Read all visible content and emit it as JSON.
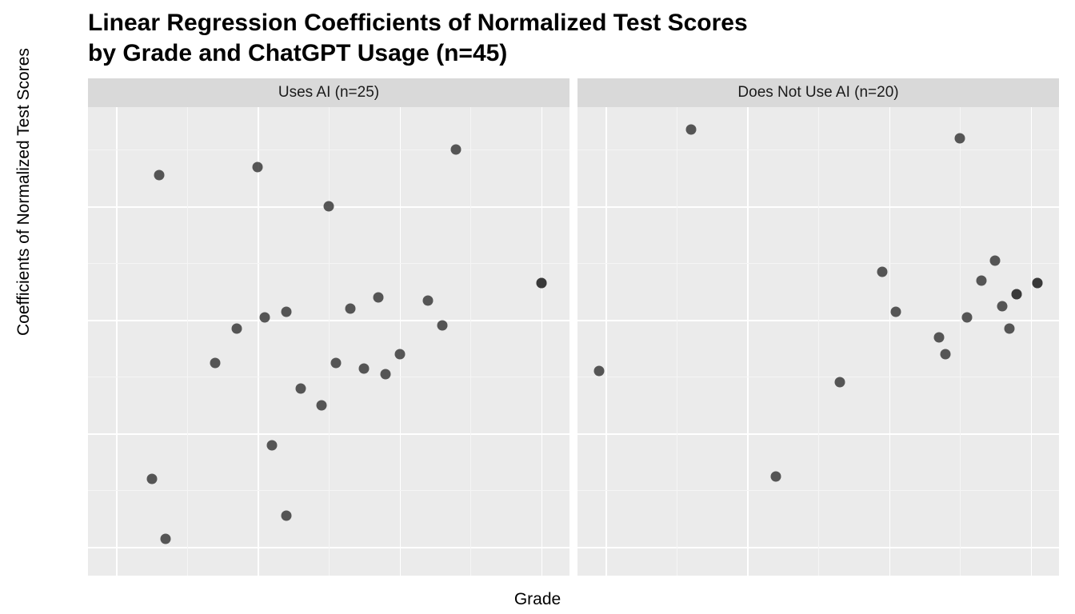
{
  "chart_data": {
    "type": "scatter",
    "title": "Linear Regression Coefficients of Normalized Test Scores\nby Grade and ChatGPT Usage (n=45)",
    "xlabel": "Grade",
    "ylabel": "Coefficients of Normalized Test Scores",
    "x_range": [
      36,
      104
    ],
    "y_range": [
      -0.9,
      0.75
    ],
    "x_ticks": [
      40,
      60,
      80,
      100
    ],
    "y_ticks": [
      -0.8,
      -0.4,
      0.0,
      0.4
    ],
    "facets": [
      {
        "label": "Uses AI (n=25)",
        "points": [
          {
            "x": 45,
            "y": -0.56
          },
          {
            "x": 46,
            "y": 0.51
          },
          {
            "x": 47,
            "y": -0.77
          },
          {
            "x": 54,
            "y": -0.15
          },
          {
            "x": 57,
            "y": -0.03
          },
          {
            "x": 60,
            "y": 0.54
          },
          {
            "x": 61,
            "y": 0.01
          },
          {
            "x": 62,
            "y": -0.44
          },
          {
            "x": 64,
            "y": 0.03
          },
          {
            "x": 64,
            "y": -0.69
          },
          {
            "x": 66,
            "y": -0.24
          },
          {
            "x": 69,
            "y": -0.3
          },
          {
            "x": 70,
            "y": 0.4
          },
          {
            "x": 71,
            "y": -0.15
          },
          {
            "x": 73,
            "y": 0.04
          },
          {
            "x": 75,
            "y": -0.17
          },
          {
            "x": 77,
            "y": 0.08
          },
          {
            "x": 78,
            "y": -0.19
          },
          {
            "x": 80,
            "y": -0.12
          },
          {
            "x": 84,
            "y": 0.07
          },
          {
            "x": 86,
            "y": -0.02
          },
          {
            "x": 88,
            "y": 0.6
          },
          {
            "x": 100,
            "y": 0.13
          },
          {
            "x": 100,
            "y": 0.13
          }
        ]
      },
      {
        "label": "Does Not Use AI (n=20)",
        "points": [
          {
            "x": 39,
            "y": -0.18
          },
          {
            "x": 52,
            "y": 0.67
          },
          {
            "x": 64,
            "y": -0.55
          },
          {
            "x": 73,
            "y": -0.22
          },
          {
            "x": 79,
            "y": 0.17
          },
          {
            "x": 81,
            "y": 0.03
          },
          {
            "x": 87,
            "y": -0.06
          },
          {
            "x": 88,
            "y": -0.12
          },
          {
            "x": 90,
            "y": 0.64
          },
          {
            "x": 91,
            "y": 0.01
          },
          {
            "x": 93,
            "y": 0.14
          },
          {
            "x": 95,
            "y": 0.21
          },
          {
            "x": 96,
            "y": 0.05
          },
          {
            "x": 97,
            "y": -0.03
          },
          {
            "x": 98,
            "y": 0.09
          },
          {
            "x": 98,
            "y": 0.09
          },
          {
            "x": 101,
            "y": 0.13
          },
          {
            "x": 101,
            "y": 0.13
          }
        ]
      }
    ]
  },
  "title_line1": "Linear Regression Coefficients of Normalized Test Scores",
  "title_line2": "by Grade and ChatGPT Usage (n=45)"
}
